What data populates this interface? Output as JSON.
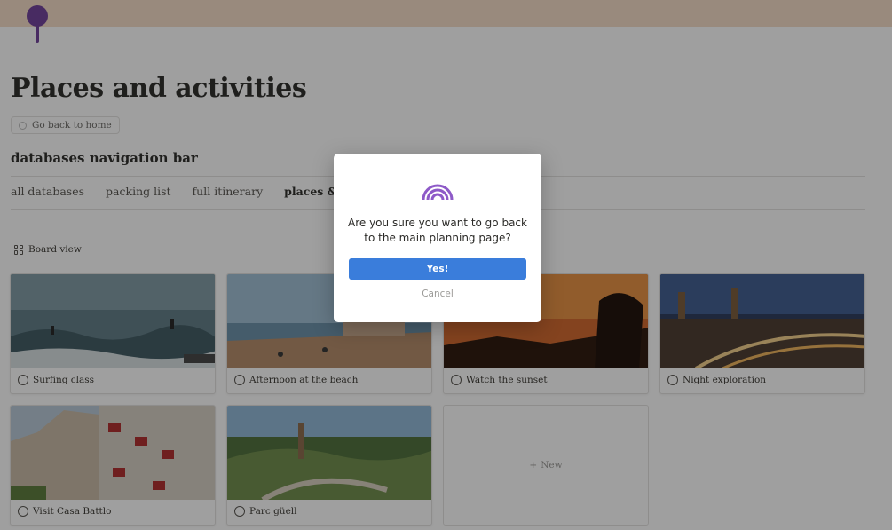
{
  "page": {
    "title": "Places and activities",
    "back_button": "Go back to home"
  },
  "nav": {
    "title": "databases navigation bar",
    "items": [
      "all databases",
      "packing list",
      "full itinerary",
      "places & activities"
    ]
  },
  "view": {
    "label": "Board view"
  },
  "cards": [
    {
      "label": "Surfing class",
      "image": "surfers-on-wave"
    },
    {
      "label": "Afternoon at the beach",
      "image": "beach-with-people"
    },
    {
      "label": "Watch the sunset",
      "image": "sunset-silhouette"
    },
    {
      "label": "Night exploration",
      "image": "city-at-night"
    },
    {
      "label": "Visit Casa Battlo",
      "image": "building-facade"
    },
    {
      "label": "Parc güell",
      "image": "park-overlook"
    }
  ],
  "new_card": {
    "label": "New"
  },
  "modal": {
    "icon": "rainbow-icon",
    "message": "Are you sure you want to go back to the main planning page?",
    "confirm_label": "Yes!",
    "cancel_label": "Cancel"
  },
  "colors": {
    "accent_blue": "#3a7ddb",
    "rainbow_purple": "#8e5ac8",
    "cover": "#f6ddc6"
  }
}
